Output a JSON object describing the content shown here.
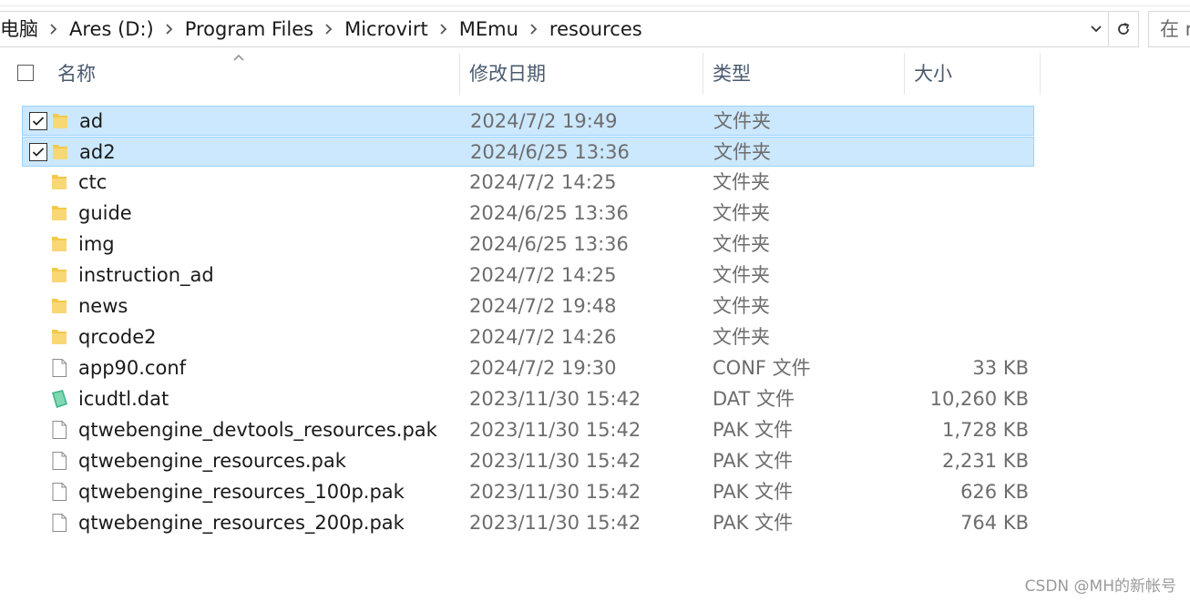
{
  "address_bar": {
    "crumbs": [
      "电脑",
      "Ares (D:)",
      "Program Files",
      "Microvirt",
      "MEmu",
      "resources"
    ]
  },
  "search": {
    "placeholder": "在 r"
  },
  "columns": {
    "name": "名称",
    "date": "修改日期",
    "type": "类型",
    "size": "大小"
  },
  "icons": {
    "folder": "folder-icon",
    "file": "file-icon",
    "dat": "dat-file-icon",
    "checkbox": "checkbox-icon",
    "refresh": "refresh-icon",
    "dropdown": "chevron-down-icon",
    "separator": "chevron-right-icon"
  },
  "colors": {
    "selection_bg": "#cce8ff",
    "selection_border": "#99d1ff",
    "folder": "#f4c84a"
  },
  "files": [
    {
      "name": "ad",
      "date": "2024/7/2 19:49",
      "type": "文件夹",
      "size": "",
      "kind": "folder",
      "selected": true
    },
    {
      "name": "ad2",
      "date": "2024/6/25 13:36",
      "type": "文件夹",
      "size": "",
      "kind": "folder",
      "selected": true
    },
    {
      "name": "ctc",
      "date": "2024/7/2 14:25",
      "type": "文件夹",
      "size": "",
      "kind": "folder",
      "selected": false
    },
    {
      "name": "guide",
      "date": "2024/6/25 13:36",
      "type": "文件夹",
      "size": "",
      "kind": "folder",
      "selected": false
    },
    {
      "name": "img",
      "date": "2024/6/25 13:36",
      "type": "文件夹",
      "size": "",
      "kind": "folder",
      "selected": false
    },
    {
      "name": "instruction_ad",
      "date": "2024/7/2 14:25",
      "type": "文件夹",
      "size": "",
      "kind": "folder",
      "selected": false
    },
    {
      "name": "news",
      "date": "2024/7/2 19:48",
      "type": "文件夹",
      "size": "",
      "kind": "folder",
      "selected": false
    },
    {
      "name": "qrcode2",
      "date": "2024/7/2 14:26",
      "type": "文件夹",
      "size": "",
      "kind": "folder",
      "selected": false
    },
    {
      "name": "app90.conf",
      "date": "2024/7/2 19:30",
      "type": "CONF 文件",
      "size": "33 KB",
      "kind": "file",
      "selected": false
    },
    {
      "name": "icudtl.dat",
      "date": "2023/11/30 15:42",
      "type": "DAT 文件",
      "size": "10,260 KB",
      "kind": "dat",
      "selected": false
    },
    {
      "name": "qtwebengine_devtools_resources.pak",
      "date": "2023/11/30 15:42",
      "type": "PAK 文件",
      "size": "1,728 KB",
      "kind": "file",
      "selected": false
    },
    {
      "name": "qtwebengine_resources.pak",
      "date": "2023/11/30 15:42",
      "type": "PAK 文件",
      "size": "2,231 KB",
      "kind": "file",
      "selected": false
    },
    {
      "name": "qtwebengine_resources_100p.pak",
      "date": "2023/11/30 15:42",
      "type": "PAK 文件",
      "size": "626 KB",
      "kind": "file",
      "selected": false
    },
    {
      "name": "qtwebengine_resources_200p.pak",
      "date": "2023/11/30 15:42",
      "type": "PAK 文件",
      "size": "764 KB",
      "kind": "file",
      "selected": false
    }
  ],
  "watermark": "CSDN @MH的新帐号"
}
